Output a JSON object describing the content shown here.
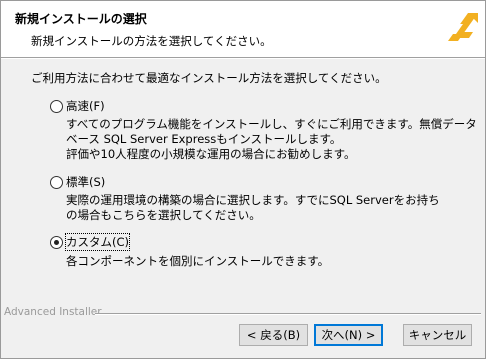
{
  "header": {
    "title": "新規インストールの選択",
    "subtitle": "新規インストールの方法を選択してください。",
    "logo_icon": "advanced-installer-logo",
    "logo_color": "#f2b021"
  },
  "prompt": "ご利用方法に合わせて最適なインストール方法を選択してください。",
  "options": [
    {
      "label": "高速(F)",
      "selected": false,
      "description": [
        "すべてのプログラム機能をインストールし、すぐにご利用できます。無償データ",
        "ベース SQL Server Expressもインストールします。",
        "評価や10人程度の小規模な運用の場合にお勧めします。"
      ]
    },
    {
      "label": "標準(S)",
      "selected": false,
      "description": [
        "実際の運用環境の構築の場合に選択します。すでにSQL Serverをお持ち",
        "の場合もこちらを選択してください。"
      ]
    },
    {
      "label": "カスタム(C)",
      "selected": true,
      "description": [
        "各コンポーネントを個別にインストールできます。"
      ]
    }
  ],
  "brand": "Advanced Installer",
  "buttons": {
    "back": "< 戻る(B)",
    "next": "次へ(N) >",
    "cancel": "キャンセル"
  }
}
